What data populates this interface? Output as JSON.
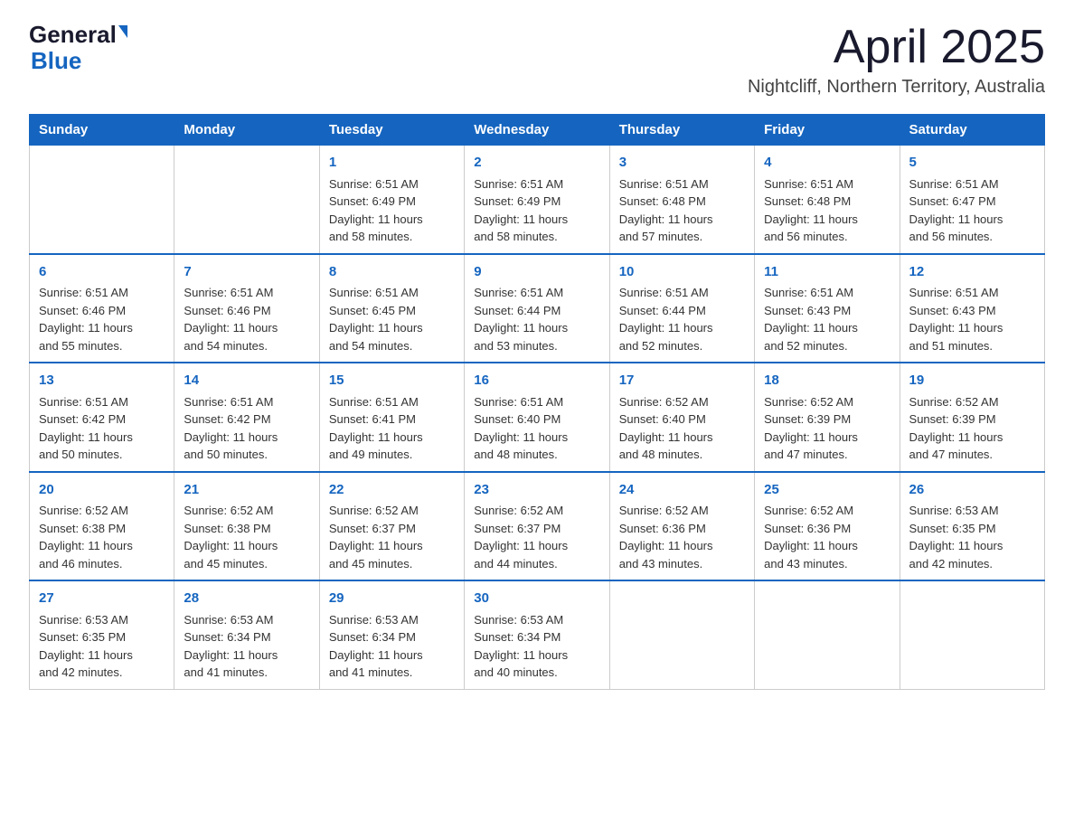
{
  "logo": {
    "general": "General",
    "blue": "Blue"
  },
  "header": {
    "month_year": "April 2025",
    "location": "Nightcliff, Northern Territory, Australia"
  },
  "days_of_week": [
    "Sunday",
    "Monday",
    "Tuesday",
    "Wednesday",
    "Thursday",
    "Friday",
    "Saturday"
  ],
  "weeks": [
    [
      {
        "day": "",
        "info": ""
      },
      {
        "day": "",
        "info": ""
      },
      {
        "day": "1",
        "info": "Sunrise: 6:51 AM\nSunset: 6:49 PM\nDaylight: 11 hours\nand 58 minutes."
      },
      {
        "day": "2",
        "info": "Sunrise: 6:51 AM\nSunset: 6:49 PM\nDaylight: 11 hours\nand 58 minutes."
      },
      {
        "day": "3",
        "info": "Sunrise: 6:51 AM\nSunset: 6:48 PM\nDaylight: 11 hours\nand 57 minutes."
      },
      {
        "day": "4",
        "info": "Sunrise: 6:51 AM\nSunset: 6:48 PM\nDaylight: 11 hours\nand 56 minutes."
      },
      {
        "day": "5",
        "info": "Sunrise: 6:51 AM\nSunset: 6:47 PM\nDaylight: 11 hours\nand 56 minutes."
      }
    ],
    [
      {
        "day": "6",
        "info": "Sunrise: 6:51 AM\nSunset: 6:46 PM\nDaylight: 11 hours\nand 55 minutes."
      },
      {
        "day": "7",
        "info": "Sunrise: 6:51 AM\nSunset: 6:46 PM\nDaylight: 11 hours\nand 54 minutes."
      },
      {
        "day": "8",
        "info": "Sunrise: 6:51 AM\nSunset: 6:45 PM\nDaylight: 11 hours\nand 54 minutes."
      },
      {
        "day": "9",
        "info": "Sunrise: 6:51 AM\nSunset: 6:44 PM\nDaylight: 11 hours\nand 53 minutes."
      },
      {
        "day": "10",
        "info": "Sunrise: 6:51 AM\nSunset: 6:44 PM\nDaylight: 11 hours\nand 52 minutes."
      },
      {
        "day": "11",
        "info": "Sunrise: 6:51 AM\nSunset: 6:43 PM\nDaylight: 11 hours\nand 52 minutes."
      },
      {
        "day": "12",
        "info": "Sunrise: 6:51 AM\nSunset: 6:43 PM\nDaylight: 11 hours\nand 51 minutes."
      }
    ],
    [
      {
        "day": "13",
        "info": "Sunrise: 6:51 AM\nSunset: 6:42 PM\nDaylight: 11 hours\nand 50 minutes."
      },
      {
        "day": "14",
        "info": "Sunrise: 6:51 AM\nSunset: 6:42 PM\nDaylight: 11 hours\nand 50 minutes."
      },
      {
        "day": "15",
        "info": "Sunrise: 6:51 AM\nSunset: 6:41 PM\nDaylight: 11 hours\nand 49 minutes."
      },
      {
        "day": "16",
        "info": "Sunrise: 6:51 AM\nSunset: 6:40 PM\nDaylight: 11 hours\nand 48 minutes."
      },
      {
        "day": "17",
        "info": "Sunrise: 6:52 AM\nSunset: 6:40 PM\nDaylight: 11 hours\nand 48 minutes."
      },
      {
        "day": "18",
        "info": "Sunrise: 6:52 AM\nSunset: 6:39 PM\nDaylight: 11 hours\nand 47 minutes."
      },
      {
        "day": "19",
        "info": "Sunrise: 6:52 AM\nSunset: 6:39 PM\nDaylight: 11 hours\nand 47 minutes."
      }
    ],
    [
      {
        "day": "20",
        "info": "Sunrise: 6:52 AM\nSunset: 6:38 PM\nDaylight: 11 hours\nand 46 minutes."
      },
      {
        "day": "21",
        "info": "Sunrise: 6:52 AM\nSunset: 6:38 PM\nDaylight: 11 hours\nand 45 minutes."
      },
      {
        "day": "22",
        "info": "Sunrise: 6:52 AM\nSunset: 6:37 PM\nDaylight: 11 hours\nand 45 minutes."
      },
      {
        "day": "23",
        "info": "Sunrise: 6:52 AM\nSunset: 6:37 PM\nDaylight: 11 hours\nand 44 minutes."
      },
      {
        "day": "24",
        "info": "Sunrise: 6:52 AM\nSunset: 6:36 PM\nDaylight: 11 hours\nand 43 minutes."
      },
      {
        "day": "25",
        "info": "Sunrise: 6:52 AM\nSunset: 6:36 PM\nDaylight: 11 hours\nand 43 minutes."
      },
      {
        "day": "26",
        "info": "Sunrise: 6:53 AM\nSunset: 6:35 PM\nDaylight: 11 hours\nand 42 minutes."
      }
    ],
    [
      {
        "day": "27",
        "info": "Sunrise: 6:53 AM\nSunset: 6:35 PM\nDaylight: 11 hours\nand 42 minutes."
      },
      {
        "day": "28",
        "info": "Sunrise: 6:53 AM\nSunset: 6:34 PM\nDaylight: 11 hours\nand 41 minutes."
      },
      {
        "day": "29",
        "info": "Sunrise: 6:53 AM\nSunset: 6:34 PM\nDaylight: 11 hours\nand 41 minutes."
      },
      {
        "day": "30",
        "info": "Sunrise: 6:53 AM\nSunset: 6:34 PM\nDaylight: 11 hours\nand 40 minutes."
      },
      {
        "day": "",
        "info": ""
      },
      {
        "day": "",
        "info": ""
      },
      {
        "day": "",
        "info": ""
      }
    ]
  ]
}
